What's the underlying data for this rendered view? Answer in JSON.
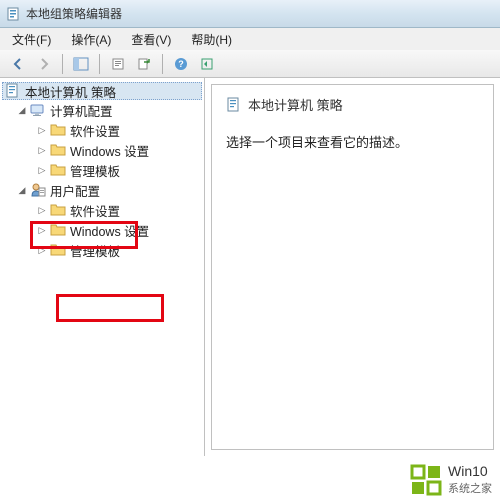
{
  "window": {
    "title": "本地组策略编辑器"
  },
  "menu": {
    "file": "文件(F)",
    "action": "操作(A)",
    "view": "查看(V)",
    "help": "帮助(H)"
  },
  "toolbar_icons": {
    "back": "back-icon",
    "forward": "forward-icon",
    "up": "show-hide-tree-icon",
    "properties": "properties-icon",
    "export": "export-list-icon",
    "refresh": "refresh-icon",
    "help": "help-icon"
  },
  "tree": {
    "root": {
      "label": "本地计算机 策略"
    },
    "computer_config": {
      "label": "计算机配置"
    },
    "cc_software": {
      "label": "软件设置"
    },
    "cc_windows": {
      "label": "Windows 设置"
    },
    "cc_admin": {
      "label": "管理模板"
    },
    "user_config": {
      "label": "用户配置"
    },
    "uc_software": {
      "label": "软件设置"
    },
    "uc_windows": {
      "label": "Windows 设置"
    },
    "uc_admin": {
      "label": "管理模板"
    }
  },
  "content": {
    "title": "本地计算机 策略",
    "description": "选择一个项目来查看它的描述。"
  },
  "watermark": {
    "line1": "Win10",
    "line2": "系统之家"
  },
  "colors": {
    "logo_green": "#7cb518"
  }
}
